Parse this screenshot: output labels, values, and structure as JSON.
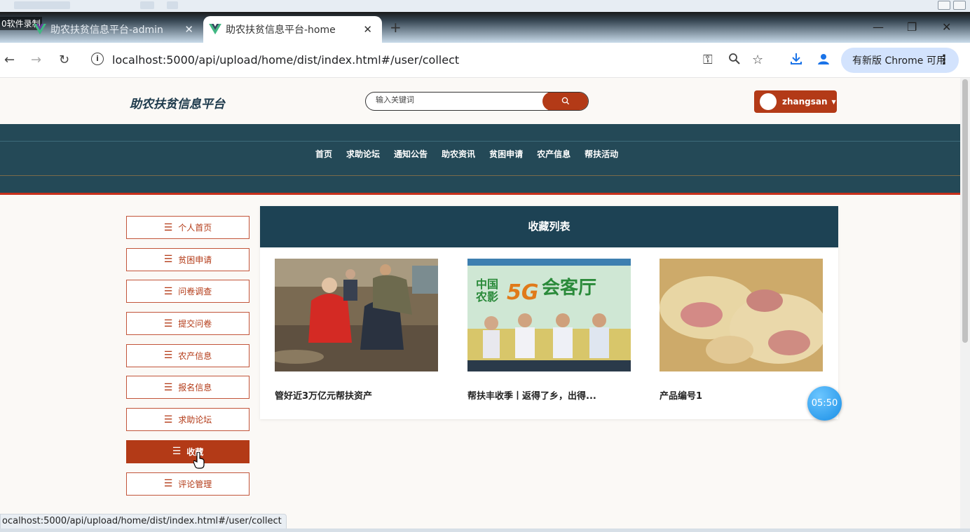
{
  "recorder": {
    "label": "0软件录制"
  },
  "browser": {
    "tabs": [
      {
        "title": "助农扶贫信息平台-admin",
        "active": false
      },
      {
        "title": "助农扶贫信息平台-home",
        "active": true
      }
    ],
    "url": "localhost:5000/api/upload/home/dist/index.html#/user/collect",
    "update_label": "有新版 Chrome 可用",
    "status_url": "ocalhost:5000/api/upload/home/dist/index.html#/user/collect"
  },
  "site": {
    "logo": "助农扶贫信息平台",
    "search_placeholder": "输入关键词",
    "user_name": "zhangsan"
  },
  "nav": {
    "items": [
      "首页",
      "求助论坛",
      "通知公告",
      "助农资讯",
      "贫困申请",
      "农产信息",
      "帮扶活动"
    ]
  },
  "sidebar": {
    "items": [
      {
        "label": "个人首页",
        "active": false
      },
      {
        "label": "贫困申请",
        "active": false
      },
      {
        "label": "问卷调查",
        "active": false
      },
      {
        "label": "提交问卷",
        "active": false
      },
      {
        "label": "农产信息",
        "active": false
      },
      {
        "label": "报名信息",
        "active": false
      },
      {
        "label": "求助论坛",
        "active": false
      },
      {
        "label": "收藏",
        "active": true
      },
      {
        "label": "评论管理",
        "active": false
      }
    ]
  },
  "collect": {
    "title": "收藏列表",
    "items": [
      {
        "title": "管好近3万亿元帮扶资产"
      },
      {
        "title": "帮扶丰收季丨返得了乡，出得..."
      },
      {
        "title": "产品编号1"
      }
    ]
  },
  "thumb2_text": {
    "line1": "中国",
    "line2": "农影",
    "brand": "5G",
    "hall": "会客厅"
  },
  "timer": "05:50",
  "colors": {
    "brand": "#b33a17",
    "nav_bg": "#244957",
    "panel_head": "#1d4254"
  }
}
